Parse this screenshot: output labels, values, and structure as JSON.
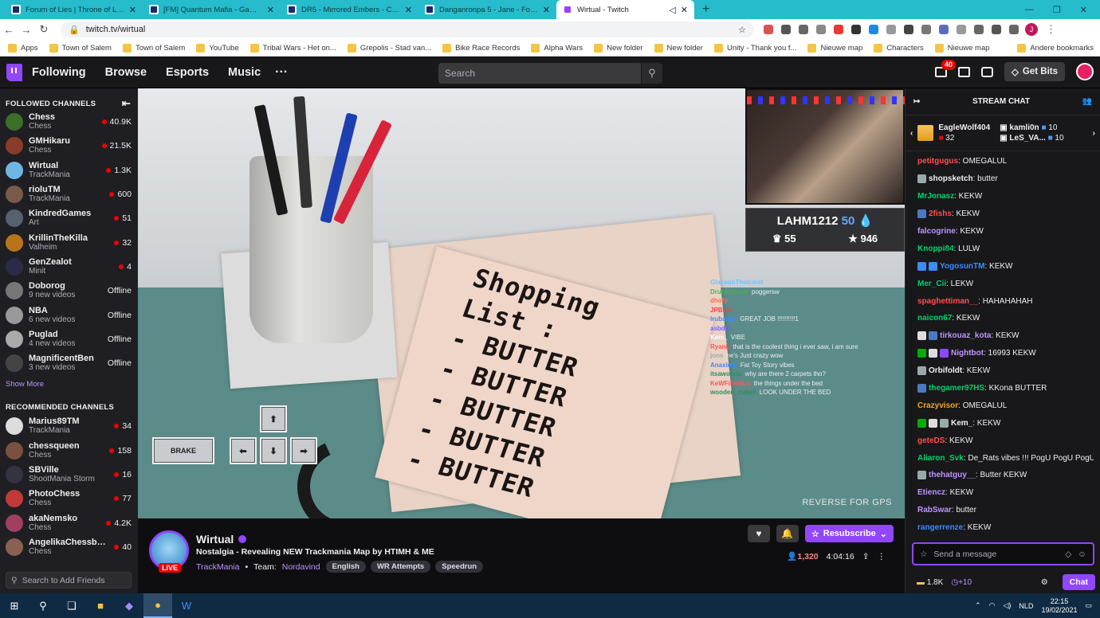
{
  "browser": {
    "tabs": [
      {
        "title": "Forum of Lies | Throne of Lies | t"
      },
      {
        "title": "[FM] Quantum Mafia - Game Th"
      },
      {
        "title": "DR5 - Mirrored Embers - Chapte"
      },
      {
        "title": "Danganronpa 5 - Jane - Forum o"
      },
      {
        "title": "Wirtual - Twitch",
        "active": true
      }
    ],
    "url": "twitch.tv/wirtual",
    "profile_initial": "J",
    "bookmarks": [
      "Apps",
      "Town of Salem",
      "Town of Salem",
      "YouTube",
      "Tribal Wars - Het on...",
      "Grepolis - Stad van...",
      "Bike Race Records",
      "Alpha Wars",
      "New folder",
      "New folder",
      "Unity - Thank you f...",
      "Nieuwe map",
      "Characters",
      "Nieuwe map"
    ],
    "other_bookmarks": "Andere bookmarks"
  },
  "topnav": {
    "links": [
      "Following",
      "Browse",
      "Esports",
      "Music"
    ],
    "more": "···",
    "search_placeholder": "Search",
    "inbox_badge": "40",
    "get_bits": "Get Bits"
  },
  "sidebar": {
    "followed_title": "FOLLOWED CHANNELS",
    "followed": [
      {
        "name": "Chess",
        "game": "Chess",
        "viewers": "40.9K",
        "live": true,
        "color": "#3b6f2a"
      },
      {
        "name": "GMHikaru",
        "game": "Chess",
        "viewers": "21.5K",
        "live": true,
        "color": "#8a3b2a"
      },
      {
        "name": "Wirtual",
        "game": "TrackMania",
        "viewers": "1.3K",
        "live": true,
        "color": "#6fb7e3"
      },
      {
        "name": "rioluTM",
        "game": "TrackMania",
        "viewers": "600",
        "live": true,
        "color": "#7a5a4a"
      },
      {
        "name": "KindredGames",
        "game": "Art",
        "viewers": "51",
        "live": true,
        "color": "#556070"
      },
      {
        "name": "KrillinTheKilla",
        "game": "Valheim",
        "viewers": "32",
        "live": true,
        "color": "#b8741a"
      },
      {
        "name": "GenZealot",
        "game": "Minit",
        "viewers": "4",
        "live": true,
        "color": "#2a2a4a"
      },
      {
        "name": "Doborog",
        "game": "9 new videos",
        "viewers": "Offline",
        "live": false,
        "color": "#777"
      },
      {
        "name": "NBA",
        "game": "6 new videos",
        "viewers": "Offline",
        "live": false,
        "color": "#999"
      },
      {
        "name": "Puglad",
        "game": "4 new videos",
        "viewers": "Offline",
        "live": false,
        "color": "#aaa"
      },
      {
        "name": "MagnificentBen",
        "game": "3 new videos",
        "viewers": "Offline",
        "live": false,
        "color": "#444"
      }
    ],
    "show_more": "Show More",
    "recommended_title": "RECOMMENDED CHANNELS",
    "recommended": [
      {
        "name": "Marius89TM",
        "game": "TrackMania",
        "viewers": "34",
        "color": "#ddd"
      },
      {
        "name": "chessqueen",
        "game": "Chess",
        "viewers": "158",
        "color": "#7a5040"
      },
      {
        "name": "SBVille",
        "game": "ShootMania Storm",
        "viewers": "16",
        "color": "#334"
      },
      {
        "name": "PhotoChess",
        "game": "Chess",
        "viewers": "77",
        "color": "#c03a3a"
      },
      {
        "name": "akaNemsko",
        "game": "Chess",
        "viewers": "4.2K",
        "color": "#a04060"
      },
      {
        "name": "AngelikaChessborn",
        "game": "Chess",
        "viewers": "40",
        "color": "#8a6050"
      }
    ],
    "add_friends": "Search to Add Friends"
  },
  "video": {
    "scoreboard": {
      "player": "LAHM1212",
      "points": "50",
      "stat1": "55",
      "stat2": "946"
    },
    "handwriting": [
      "Shopping",
      "List :",
      "- BUTTER",
      "- BUTTER",
      "- BUTTER",
      "- BUTTER",
      "- BUTTER"
    ],
    "overlay_chat": [
      {
        "user": "GlaceonThelciest",
        "msg": "",
        "color": "#6fc3ff"
      },
      {
        "user": "DrunkHorsie",
        "msg": "poggersw",
        "color": "#4caf50"
      },
      {
        "user": "dhofy",
        "msg": "",
        "color": "#ff7043"
      },
      {
        "user": "JPBraz",
        "msg": "",
        "color": "#ff3b3b"
      },
      {
        "user": "lrubanjie",
        "msg": "GREAT JOB !!!!!!!!!!1",
        "color": "#3d8bfd"
      },
      {
        "user": "asbdcx",
        "msg": "",
        "color": "#7a5cff"
      },
      {
        "user": "Kem_",
        "msg": "VIBE",
        "color": "#ffffff"
      },
      {
        "user": "RyanL",
        "msg": "that is the coolest thing i ever saw, i am sure",
        "color": "#ff5555"
      },
      {
        "user": "jons",
        "msg": "he's Just crazy wow",
        "color": "#9aa"
      },
      {
        "user": "Anaximb",
        "msg": "Fat Toy Story vibes",
        "color": "#3d8bfd"
      },
      {
        "user": "itsawondo",
        "msg": "why are there 2 carpets tho?",
        "color": "#2f8f5f"
      },
      {
        "user": "KeWFilterBot",
        "msg": "the things under the bed",
        "color": "#ff5555"
      },
      {
        "user": "wooden_cubes",
        "msg": "LOOK UNDER THE BED",
        "color": "#2f8f5f"
      }
    ],
    "keys": {
      "brake": "BRAKE",
      "up": "⬆",
      "left": "⬅",
      "down": "⬇",
      "right": "➡"
    },
    "reverse_text": "REVERSE FOR GPS"
  },
  "stream": {
    "name": "Wirtual",
    "live_label": "LIVE",
    "title": "Nostalgia - Revealing NEW Trackmania Map by HTIMH & ME",
    "game": "TrackMania",
    "team_label": "Team:",
    "team": "Nordavind",
    "tags": [
      "English",
      "WR Attempts",
      "Speedrun"
    ],
    "resubscribe": "Resubscribe",
    "viewers": "1,320",
    "uptime": "4:04:16"
  },
  "chat": {
    "title": "STREAM CHAT",
    "gifts": [
      {
        "user": "EagleWolf404",
        "count": "32"
      },
      {
        "user": "kamli0n",
        "count": "10"
      },
      {
        "user": "LeS_VA...",
        "count": "10"
      }
    ],
    "messages": [
      {
        "user": "petitgugus",
        "text": ": OMEGALUL",
        "color": "#ff4f4f",
        "badges": []
      },
      {
        "user": "shopsketch",
        "text": ": butter",
        "color": "#efeff1",
        "badges": [
          "#9aa"
        ]
      },
      {
        "user": "MrJonasz",
        "text": ": KEKW",
        "color": "#00d26a",
        "badges": []
      },
      {
        "user": "2fishs",
        "text": ": KEKW",
        "color": "#ff4f4f",
        "badges": [
          "#4a7bc0"
        ]
      },
      {
        "user": "falcogrine",
        "text": ": KEKW",
        "color": "#bf94ff",
        "badges": []
      },
      {
        "user": "Knoppi84",
        "text": ": LULW",
        "color": "#00d26a",
        "badges": []
      },
      {
        "user": "YogosunTM",
        "text": ": KEKW",
        "color": "#3d8bfd",
        "badges": [
          "#3d8bfd",
          "#3d8bfd"
        ]
      },
      {
        "user": "Mer_Cii",
        "text": ": LEKW",
        "color": "#00d26a",
        "badges": []
      },
      {
        "user": "spaghettiman__",
        "text": ": HAHAHAHAH",
        "color": "#ff4f4f",
        "badges": []
      },
      {
        "user": "naicon67",
        "text": ": KEKW",
        "color": "#00d26a",
        "badges": []
      },
      {
        "user": "tirkouaz_kota",
        "text": ": KEKW",
        "color": "#bf94ff",
        "badges": [
          "#ddd",
          "#4a7bc0"
        ]
      },
      {
        "user": "Nightbot",
        "text": ": 16993 KEKW",
        "color": "#bf94ff",
        "badges": [
          "#00ad03",
          "#ddd",
          "#9146ff"
        ]
      },
      {
        "user": "Orbifoldt",
        "text": ": KEKW",
        "color": "#efeff1",
        "badges": [
          "#9aa"
        ]
      },
      {
        "user": "thegamer97HS",
        "text": ": KKona BUTTER",
        "color": "#00d26a",
        "badges": [
          "#4a7bc0"
        ]
      },
      {
        "user": "Crazyvisor",
        "text": ": OMEGALUL",
        "color": "#f4a623",
        "badges": []
      },
      {
        "user": "Kem_",
        "text": ": KEKW",
        "color": "#efeff1",
        "badges": [
          "#00ad03",
          "#ddd",
          "#9aa"
        ]
      },
      {
        "user": "geteDS",
        "text": ": KEKW",
        "color": "#ff4f4f",
        "badges": []
      },
      {
        "user": "Aliaron_Svk",
        "text": ": De_Rats vibes !!! PogU PogU PogU",
        "color": "#00d26a",
        "badges": []
      },
      {
        "user": "thehatguy__",
        "text": ": Butter KEKW",
        "color": "#bf94ff",
        "badges": [
          "#9aa"
        ]
      },
      {
        "user": "Etiencz",
        "text": ": KEKW",
        "color": "#bf94ff",
        "badges": []
      },
      {
        "user": "RabSwar",
        "text": ": butter",
        "color": "#bf94ff",
        "badges": []
      },
      {
        "user": "rangerrenze",
        "text": ": KEKW",
        "color": "#3d8bfd",
        "badges": []
      }
    ],
    "input_placeholder": "Send a message",
    "points": "1.8K",
    "bonus": "+10",
    "chat_button": "Chat"
  },
  "taskbar": {
    "lang": "NLD",
    "time": "22:15",
    "date": "19/02/2021"
  },
  "accent": "#9146ff"
}
